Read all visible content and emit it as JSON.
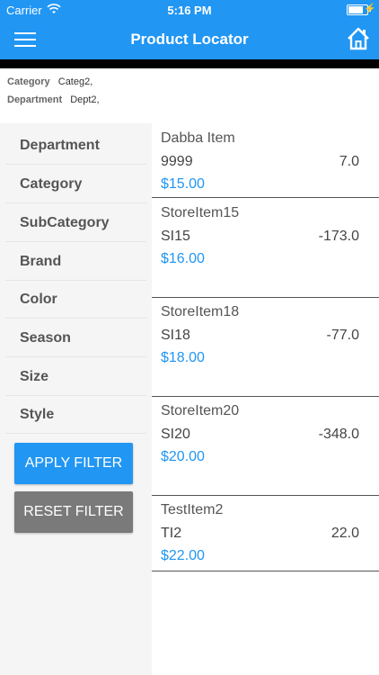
{
  "status_bar": {
    "carrier": "Carrier",
    "time": "5:16 PM"
  },
  "navbar": {
    "title": "Product Locator"
  },
  "filters_applied": {
    "category_label": "Category",
    "category_value": "Categ2,",
    "department_label": "Department",
    "department_value": "Dept2,"
  },
  "sidebar": {
    "items": [
      "Department",
      "Category",
      "SubCategory",
      "Brand",
      "Color",
      "Season",
      "Size",
      "Style"
    ],
    "apply_label": "APPLY FILTER",
    "reset_label": "RESET FILTER"
  },
  "products": [
    {
      "name": "Dabba Item",
      "code": "9999",
      "qty": "7.0",
      "price": "$15.00"
    },
    {
      "name": "StoreItem15",
      "code": "SI15",
      "qty": "-173.0",
      "price": "$16.00"
    },
    {
      "name": "StoreItem18",
      "code": "SI18",
      "qty": "-77.0",
      "price": "$18.00"
    },
    {
      "name": "StoreItem20",
      "code": "SI20",
      "qty": "-348.0",
      "price": "$20.00"
    },
    {
      "name": "TestItem2",
      "code": "TI2",
      "qty": "22.0",
      "price": "$22.00"
    }
  ],
  "colors": {
    "primary": "#2196F3",
    "reset": "#7a7a7a",
    "sidebar_bg": "#f5f5f5"
  }
}
